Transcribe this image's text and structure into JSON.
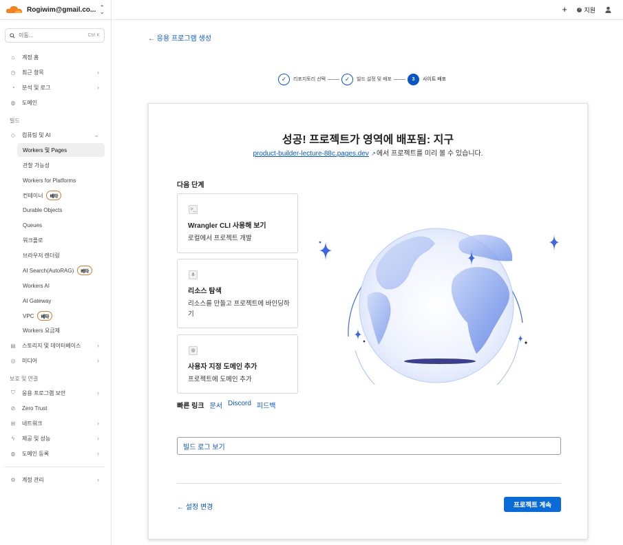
{
  "sidebar": {
    "account_email": "Rogiwim@gmail.co...",
    "search": {
      "placeholder": "이동...",
      "shortcut": "Ctrl K"
    },
    "top_items": [
      {
        "label": "계정 홈",
        "icon": "home-icon"
      },
      {
        "label": "최근 항목",
        "icon": "clock-icon"
      },
      {
        "label": "분석 및 로그",
        "icon": "chart-icon"
      },
      {
        "label": "도메인",
        "icon": "globe-icon"
      }
    ],
    "build_section": "빌드",
    "compute_group": "컴퓨팅 및 AI",
    "compute_items": [
      {
        "label": "Workers 및 Pages"
      },
      {
        "label": "관찰 가능성"
      },
      {
        "label": "Workers for Platforms"
      },
      {
        "label": "컨테이너",
        "badge": "베타"
      },
      {
        "label": "Durable Objects"
      },
      {
        "label": "Queues"
      },
      {
        "label": "워크플로"
      },
      {
        "label": "브라우저 렌더링"
      },
      {
        "label": "AI Search(AutoRAG)",
        "badge": "베타"
      },
      {
        "label": "Workers AI"
      },
      {
        "label": "AI Gateway"
      },
      {
        "label": "VPC",
        "badge": "베타"
      },
      {
        "label": "Workers 요금제"
      }
    ],
    "storage_item": "스토리지 및 데이터베이스",
    "media_item": "미디어",
    "protect_section": "보호 및 연결",
    "protect_items": [
      {
        "label": "응용 프로그램 보안"
      },
      {
        "label": "Zero Trust"
      },
      {
        "label": "네트워크"
      },
      {
        "label": "제공 및 성능"
      },
      {
        "label": "도메인 등록"
      }
    ],
    "account_manage": "계정 관리"
  },
  "topbar": {
    "support": "지원"
  },
  "main": {
    "back_link": "← 응용 프로그램 생성",
    "steps": [
      {
        "label": "리포지토리 선택",
        "status": "done"
      },
      {
        "label": "빌드 설정 및 배포",
        "status": "done"
      },
      {
        "label": "사이트 배포",
        "status": "current",
        "number": "3"
      }
    ],
    "card": {
      "title": "성공! 프로젝트가 영역에 배포됨: 지구",
      "link": "product-builder-lecture-88c.pages.dev",
      "link_suffix": "에서 프로젝트를 미리 볼 수 있습니다.",
      "next_steps_label": "다음 단계",
      "options": [
        {
          "title": "Wrangler CLI 사용해 보기",
          "desc": "로컬에서 프로젝트 개발",
          "icon": "terminal-icon"
        },
        {
          "title": "리소스 탐색",
          "desc": "리소스를 만들고 프로젝트에 바인딩하기",
          "icon": "hierarchy-icon"
        },
        {
          "title": "사용자 지정 도메인 추가",
          "desc": "프로젝트에 도메인 추가",
          "icon": "globe-icon"
        }
      ],
      "quick_links_label": "빠른 링크",
      "quick_links": [
        "문서",
        "Discord",
        "피드백"
      ],
      "view_log_button": "빌드 로그 보기",
      "change_settings": "← 설정 변경",
      "continue_button": "프로젝트 계속"
    }
  },
  "colors": {
    "accent": "#0a57c2",
    "button": "#0a6bd6",
    "brand": "#f48120",
    "badge_border": "#d67b2a"
  }
}
